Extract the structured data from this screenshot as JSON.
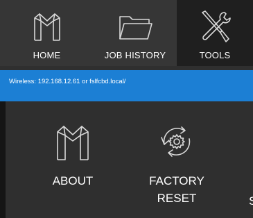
{
  "nav": {
    "items": [
      {
        "label": "HOME",
        "icon": "logo-icon"
      },
      {
        "label": "JOB HISTORY",
        "icon": "folder-icon"
      },
      {
        "label": "TOOLS",
        "icon": "tools-icon",
        "active": true
      }
    ]
  },
  "status": {
    "text": "Wireless: 192.168.12.61  or fslfcbd.local/"
  },
  "tiles": [
    {
      "label": "ABOUT",
      "icon": "logo-icon"
    },
    {
      "label_line1": "FACTORY",
      "label_line2": "RESET",
      "icon": "factory-reset-icon"
    },
    {
      "label": "S"
    }
  ],
  "colors": {
    "nav_bg": "#363636",
    "nav_active_bg": "#1f1f1f",
    "status_bg": "#1c7fd4",
    "main_bg": "#2f2f2f",
    "text": "#ffffff"
  }
}
